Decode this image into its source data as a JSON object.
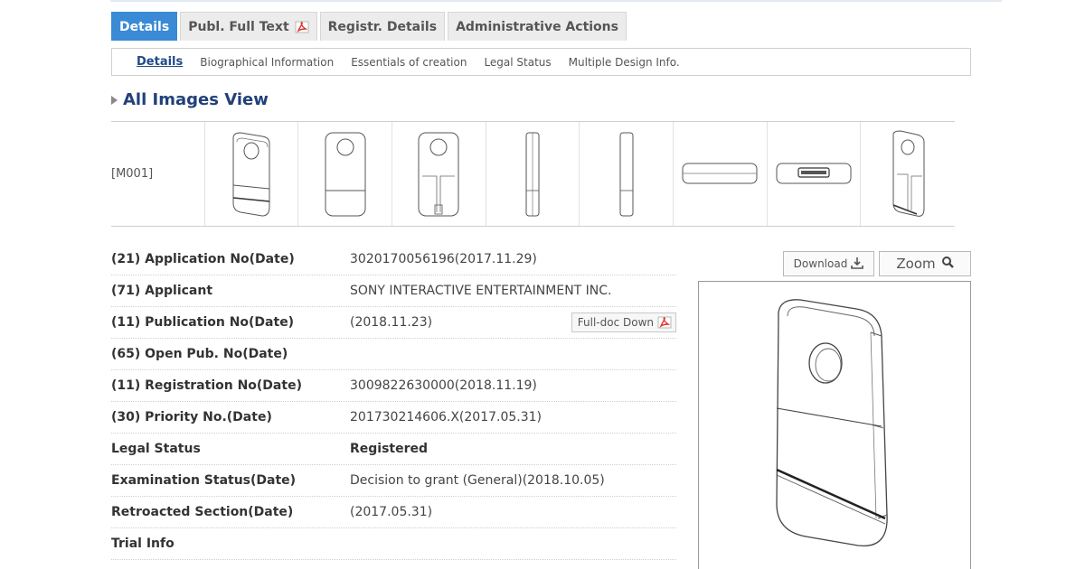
{
  "main_tabs": [
    {
      "label": "Details",
      "active": true
    },
    {
      "label": "Publ. Full Text",
      "active": false,
      "icon": "pdf-icon"
    },
    {
      "label": "Registr. Details",
      "active": false
    },
    {
      "label": "Administrative Actions",
      "active": false
    }
  ],
  "sub_tabs": [
    {
      "label": "Details",
      "active": true
    },
    {
      "label": "Biographical Information",
      "active": false
    },
    {
      "label": "Essentials of creation",
      "active": false
    },
    {
      "label": "Legal Status",
      "active": false
    },
    {
      "label": "Multiple Design Info.",
      "active": false
    }
  ],
  "section": {
    "title": "All Images View"
  },
  "images": {
    "code": "[M001]",
    "thumbnail_count": 8
  },
  "details": [
    {
      "label": "(21) Application No(Date)",
      "value": "3020170056196(2017.11.29)"
    },
    {
      "label": "(71) Applicant",
      "value": "SONY INTERACTIVE ENTERTAINMENT INC."
    },
    {
      "label": "(11) Publication No(Date)",
      "value": "(2018.11.23)",
      "button": "Full-doc Down"
    },
    {
      "label": "(65) Open Pub. No(Date)",
      "value": ""
    },
    {
      "label": "(11) Registration No(Date)",
      "value": "3009822630000(2018.11.19)"
    },
    {
      "label": "(30) Priority No.(Date)",
      "value": "201730214606.X(2017.05.31)"
    },
    {
      "label": "Legal Status",
      "value": "Registered"
    },
    {
      "label": "Examination Status(Date)",
      "value": "Decision to grant (General)(2018.10.05)"
    },
    {
      "label": "Retroacted Section(Date)",
      "value": "(2017.05.31)"
    },
    {
      "label": "Trial Info",
      "value": ""
    }
  ],
  "buttons": {
    "download": "Download",
    "zoom": "Zoom"
  },
  "colors": {
    "active_tab": "#3a8ad6",
    "heading": "#22407a",
    "pdf_red": "#e0322c"
  }
}
